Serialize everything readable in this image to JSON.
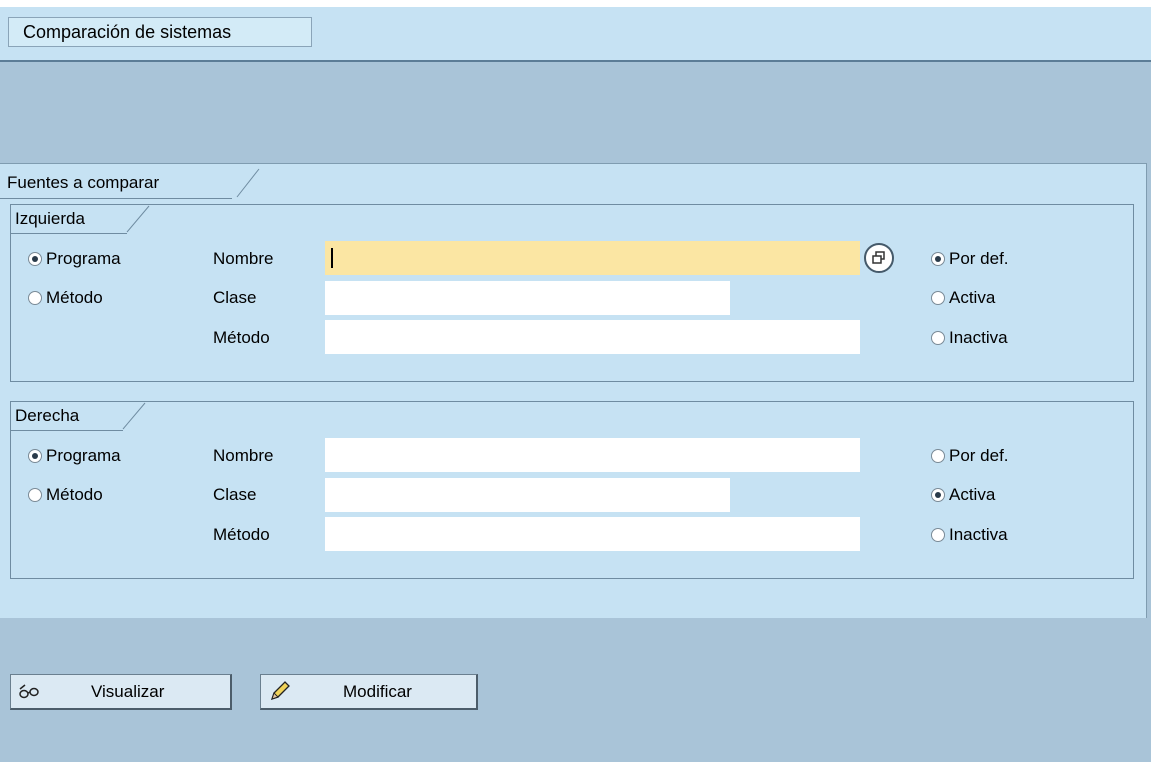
{
  "header": {
    "title": "Comparación de sistemas"
  },
  "sources": {
    "title": "Fuentes a comparar",
    "left": {
      "title": "Izquierda",
      "radio_programa": "Programa",
      "radio_metodo": "Método",
      "programa_selected": true,
      "label_nombre": "Nombre",
      "label_clase": "Clase",
      "label_metodo": "Método",
      "nombre_value": "",
      "clase_value": "",
      "metodo_value": "",
      "version_por_def": "Por def.",
      "version_activa": "Activa",
      "version_inactiva": "Inactiva",
      "selected_version": "Por def."
    },
    "right": {
      "title": "Derecha",
      "radio_programa": "Programa",
      "radio_metodo": "Método",
      "programa_selected": true,
      "label_nombre": "Nombre",
      "label_clase": "Clase",
      "label_metodo": "Método",
      "nombre_value": "",
      "clase_value": "",
      "metodo_value": "",
      "version_por_def": "Por def.",
      "version_activa": "Activa",
      "version_inactiva": "Inactiva",
      "selected_version": "Activa"
    }
  },
  "actions": {
    "visualizar_label": "Visualizar",
    "visualizar_icon": "glasses-icon",
    "modificar_label": "Modificar",
    "modificar_icon": "pencil-icon"
  },
  "colors": {
    "background": "#a9c4d8",
    "panel": "#c6e2f3",
    "focused_field": "#fbe6a3"
  }
}
